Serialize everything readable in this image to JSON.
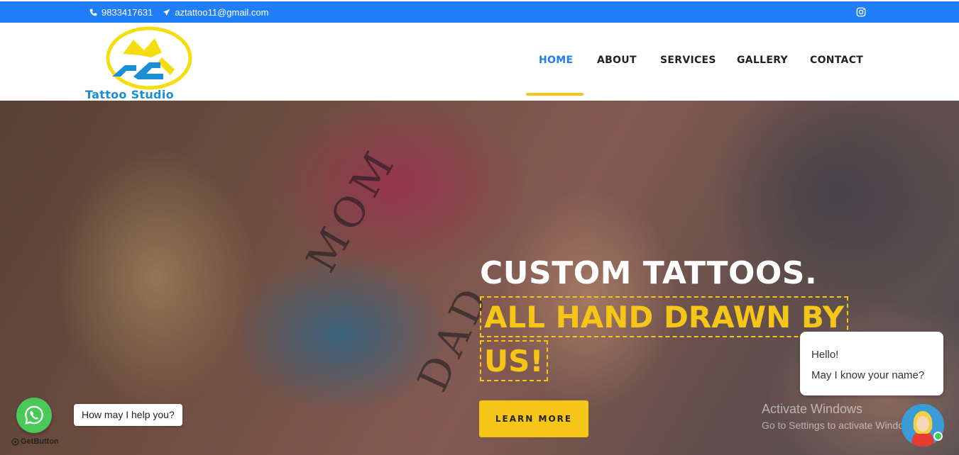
{
  "topbar": {
    "phone": "9833417631",
    "email": "aztattoo11@gmail.com",
    "bg_color": "#1f7ef8",
    "social_icon": "instagram-icon"
  },
  "header": {
    "logo_text": "Tattoo Studio",
    "nav": [
      {
        "label": "HOME",
        "active": true
      },
      {
        "label": "ABOUT",
        "active": false
      },
      {
        "label": "SERVICES",
        "active": false
      },
      {
        "label": "GALLERY",
        "active": false
      },
      {
        "label": "CONTACT",
        "active": false
      }
    ],
    "accent_color": "#f5c518"
  },
  "hero": {
    "title": "CUSTOM TATTOOS.",
    "subtitle_line1": "ALL HAND DRAWN BY",
    "subtitle_line2": "US!",
    "cta_label": "LEARN MORE",
    "tattoo_text_1": "MOM",
    "tattoo_text_2": "DAD"
  },
  "overlay": {
    "activate_title": "Activate Windows",
    "activate_sub": "Go to Settings to activate Windows."
  },
  "chat": {
    "line1": "Hello!",
    "line2": "May I know your name?"
  },
  "whatsapp": {
    "tooltip": "How may I help you?",
    "brand": "GetButton",
    "color": "#4ac959"
  }
}
